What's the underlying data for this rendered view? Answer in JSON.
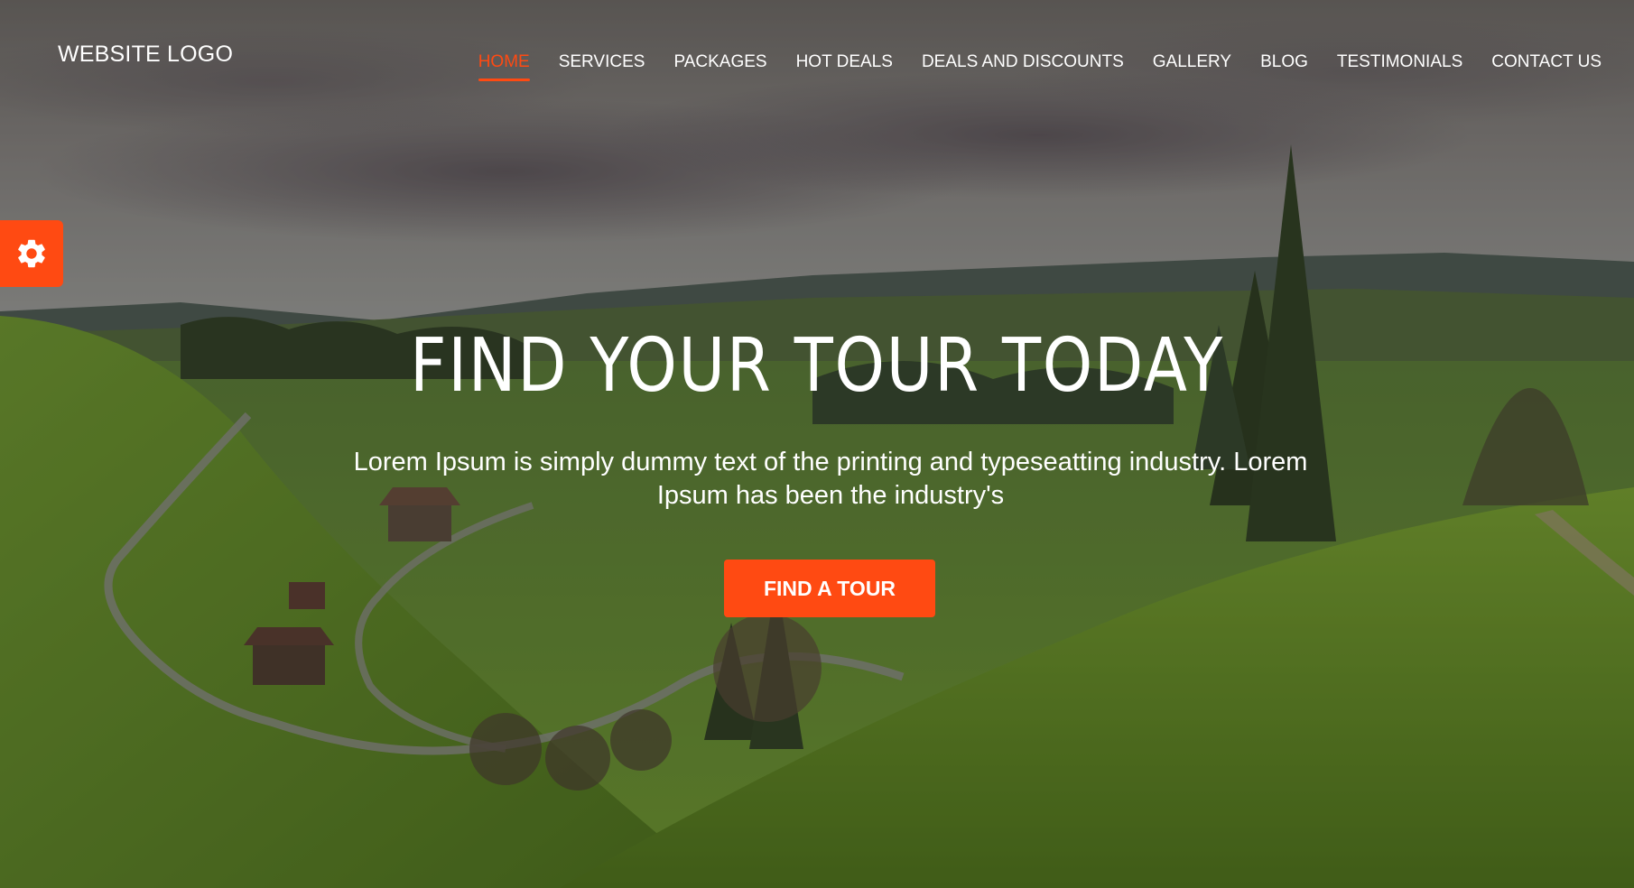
{
  "header": {
    "logo": "WEBSITE LOGO",
    "nav": [
      {
        "label": "HOME",
        "active": true
      },
      {
        "label": "SERVICES"
      },
      {
        "label": "PACKAGES"
      },
      {
        "label": "HOT DEALS"
      },
      {
        "label": "DEALS AND DISCOUNTS"
      },
      {
        "label": "GALLERY"
      },
      {
        "label": "BLOG"
      },
      {
        "label": "TESTIMONIALS"
      },
      {
        "label": "CONTACT US"
      }
    ]
  },
  "hero": {
    "headline": "FIND YOUR TOUR TODAY",
    "subtext": "Lorem Ipsum is simply dummy text of the printing and typeseatting industry. Lorem Ipsum has been the industry's",
    "cta_label": "FIND A TOUR"
  },
  "settings": {
    "icon": "gear-icon"
  },
  "colors": {
    "accent": "#ff4a12",
    "text": "#ffffff"
  }
}
